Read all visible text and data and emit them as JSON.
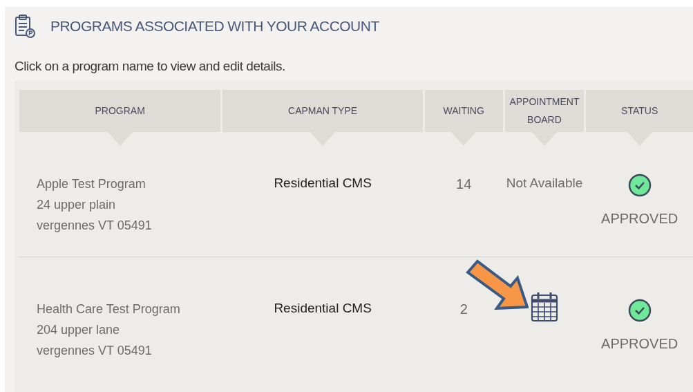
{
  "section": {
    "title": "PROGRAMS ASSOCIATED WITH YOUR ACCOUNT",
    "instruction": "Click on a program name to view and edit details."
  },
  "table": {
    "columns": [
      "PROGRAM",
      "CAPMAN TYPE",
      "WAITING",
      "APPOINTMENT BOARD",
      "STATUS"
    ],
    "rows": [
      {
        "program": {
          "name": "Apple Test Program",
          "address": [
            "24 upper plain",
            "vergennes VT 05491"
          ]
        },
        "capman_type": "Residential CMS",
        "waiting": "14",
        "appointment_board": {
          "kind": "text",
          "text": "Not Available"
        },
        "status": {
          "kind": "approved",
          "label": "APPROVED"
        },
        "pointed_at": false
      },
      {
        "program": {
          "name": "Health Care Test Program",
          "address": [
            "204 upper lane",
            "vergennes VT 05491"
          ]
        },
        "capman_type": "Residential CMS",
        "waiting": "2",
        "appointment_board": {
          "kind": "calendar"
        },
        "status": {
          "kind": "approved",
          "label": "APPROVED"
        },
        "pointed_at": true
      }
    ]
  }
}
